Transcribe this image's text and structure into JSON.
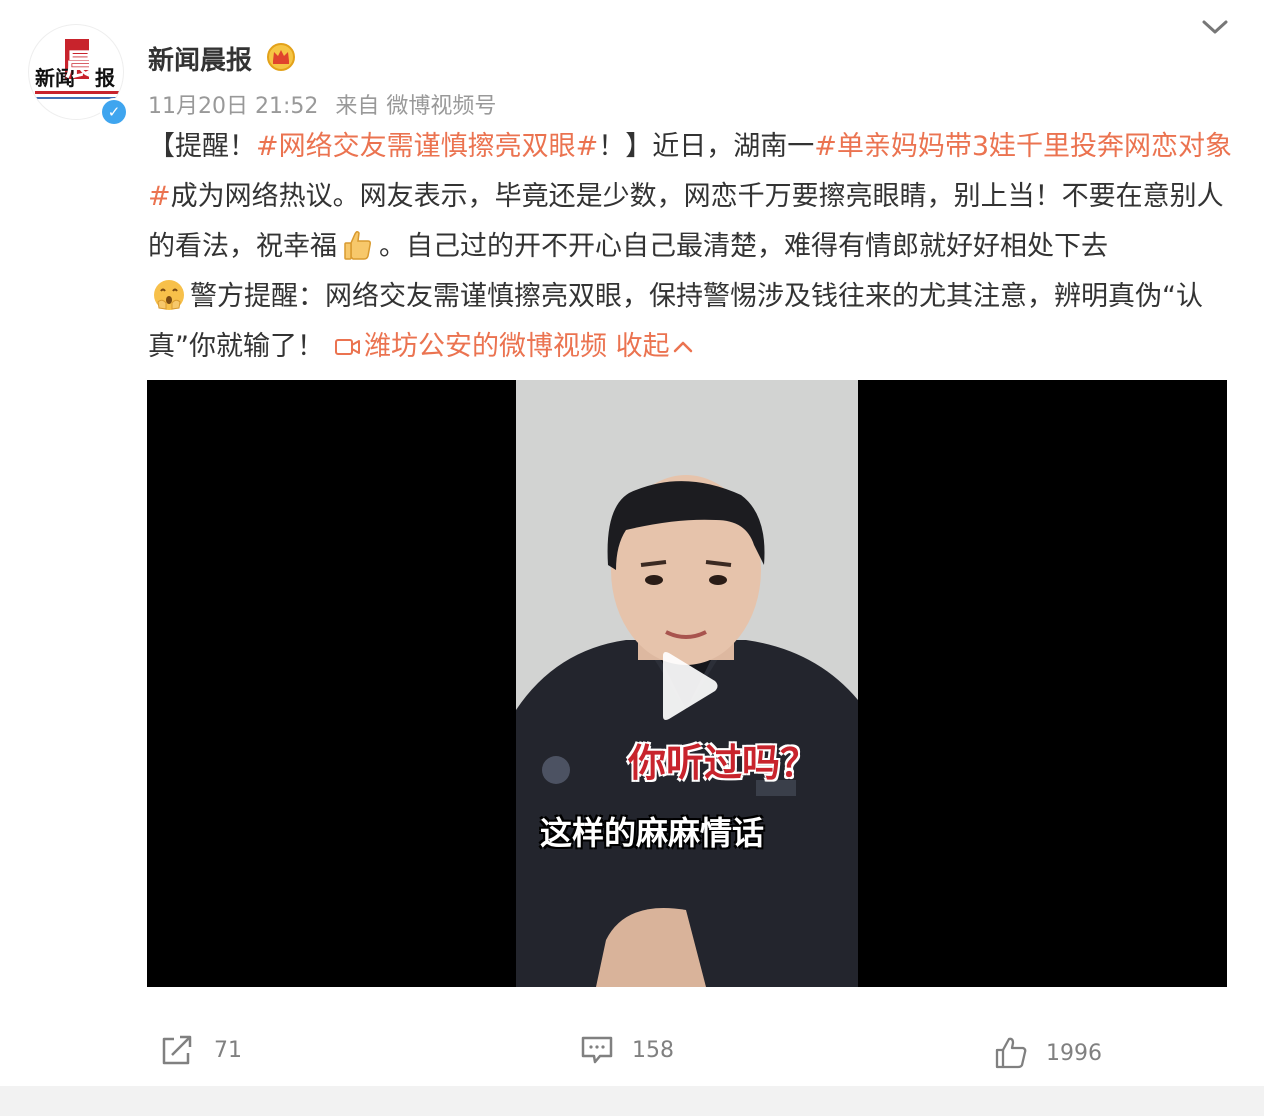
{
  "post": {
    "username": "新闻晨报",
    "time": "11月20日 21:52",
    "source": "来自 微博视频号",
    "avatar_text_a": "新闻",
    "avatar_text_b": "晨",
    "avatar_text_c": "报",
    "content": {
      "p1": "【提醒！",
      "tag1": "#网络交友需谨慎擦亮双眼#",
      "p2": "！】近日，湖南一",
      "tag2": "#单亲妈妈带3娃千里投奔网恋对象#",
      "p3": "成为网络热议。网友表示，毕竟还是少数，网恋千万要擦亮眼睛，别上当！不要在意别人的看法，祝幸福",
      "p4": "。自己过的开不开心自己最清楚，难得有情郎就好好相处下去",
      "p5": "警方提醒：网络交友需谨慎擦亮双眼，保持警惕涉及钱往来的尤其注意，辨明真伪“认真”你就输了！",
      "video_link": "潍坊公安的微博视频",
      "collapse": "收起"
    },
    "video": {
      "subtitle_red": "你听过吗？",
      "subtitle_white": "这样的麻麻情话"
    },
    "actions": {
      "repost_count": "71",
      "comment_count": "158",
      "like_count": "1996"
    },
    "colors": {
      "accent": "#eb7350",
      "verified": "#3fa5ef"
    },
    "icons": [
      "crown-icon",
      "verified-icon",
      "chevron-down-icon",
      "thumbs-up-emoji",
      "hush-emoji",
      "video-icon",
      "chevron-up-icon",
      "play-icon",
      "repost-icon",
      "comment-icon",
      "like-icon"
    ]
  }
}
